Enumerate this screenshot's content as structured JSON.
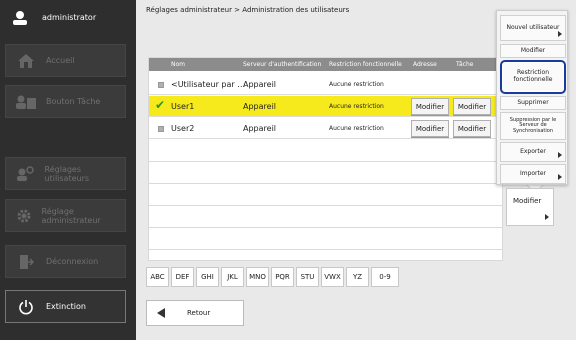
{
  "sidebar": {
    "user": "administrator",
    "items": [
      {
        "label": "Accueil"
      },
      {
        "label": "Bouton Tâche"
      },
      {
        "label": "Réglages utilisateurs"
      },
      {
        "label": "Réglage administrateur"
      },
      {
        "label": "Déconnexion"
      },
      {
        "label": "Extinction"
      }
    ]
  },
  "breadcrumb": "Réglages administrateur > Administration des utilisateurs",
  "table": {
    "headers": [
      "Nom",
      "Serveur d'authentification",
      "Restriction fonctionnelle",
      "Adresse",
      "Tâche"
    ],
    "rows": [
      {
        "name": "<Utilisateur par …",
        "server": "Appareil",
        "restriction": "Aucune restriction",
        "selected": false
      },
      {
        "name": "User1",
        "server": "Appareil",
        "restriction": "Aucune restriction",
        "btn1": "Modifier",
        "btn2": "Modifier",
        "selected": true
      },
      {
        "name": "User2",
        "server": "Appareil",
        "restriction": "Aucune restriction",
        "btn1": "Modifier",
        "btn2": "Modifier",
        "selected": false
      }
    ]
  },
  "alpha_tabs": [
    "ABC",
    "DEF",
    "GHI",
    "JKL",
    "MNO",
    "PQR",
    "STU",
    "VWX",
    "YZ",
    "0-9"
  ],
  "back_label": "Retour",
  "menu": {
    "items": [
      "Nouvel utilisateur",
      "Modifier",
      "Restriction fonctionnelle",
      "Supprimer",
      "Suppression par le Serveur de Synchronisation",
      "Exporter",
      "Importer"
    ]
  },
  "modify_button": "Modifier",
  "colors": {
    "highlight": "#f7ea1c",
    "focus_ring": "#1b3b9c",
    "sidebar_bg": "#2e2e2e"
  }
}
